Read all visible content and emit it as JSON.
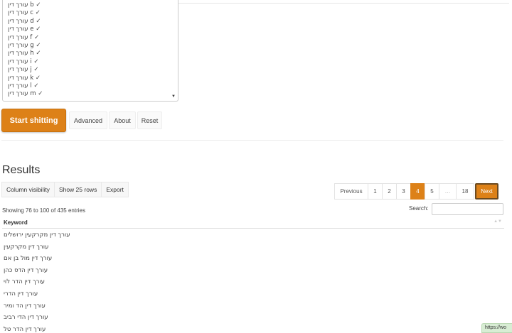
{
  "keyword_list": {
    "lines": [
      "עורך דין b ✓",
      "עורך דין c ✓",
      "עורך דין d ✓",
      "עורך דין e ✓",
      "עורך דין f ✓",
      "עורך דין g ✓",
      "עורך דין h ✓",
      "עורך דין i ✓",
      "עורך דין j ✓",
      "עורך דין k ✓",
      "עורך דין l ✓",
      "עורך דין m ✓"
    ],
    "scroll_arrow": "▼"
  },
  "actions": {
    "start_label": "Start shitting",
    "advanced_label": "Advanced",
    "about_label": "About",
    "reset_label": "Reset"
  },
  "results": {
    "title": "Results",
    "buttons": {
      "column_visibility": "Column visibility",
      "show_rows": "Show 25 rows",
      "export": "Export"
    },
    "pagination": {
      "previous": "Previous",
      "pages": [
        "1",
        "2",
        "3",
        "4",
        "5"
      ],
      "active_page": "4",
      "ellipsis": "…",
      "last_page": "18",
      "next": "Next"
    },
    "info": "Showing 76 to 100 of 435 entries",
    "search_label": "Search:",
    "search_value": "",
    "table": {
      "column": "Keyword",
      "sort_icon": "▲▼",
      "rows": [
        "עורך דין מקרקעין ירושלים",
        "עורך דין מקרקעין",
        "עורך דין מול בן אם",
        "עורך דין הדס כהן",
        "עורך דין הדר לוי",
        "עורך דין הדרי",
        "עורך דין הד ומיר",
        "עורך דין הדי רביב",
        "עורך דין הדר טל"
      ]
    }
  },
  "status_bar": {
    "url": "https://wo"
  },
  "colors": {
    "accent": "#dd8118",
    "status_bg": "#d8edd4"
  }
}
